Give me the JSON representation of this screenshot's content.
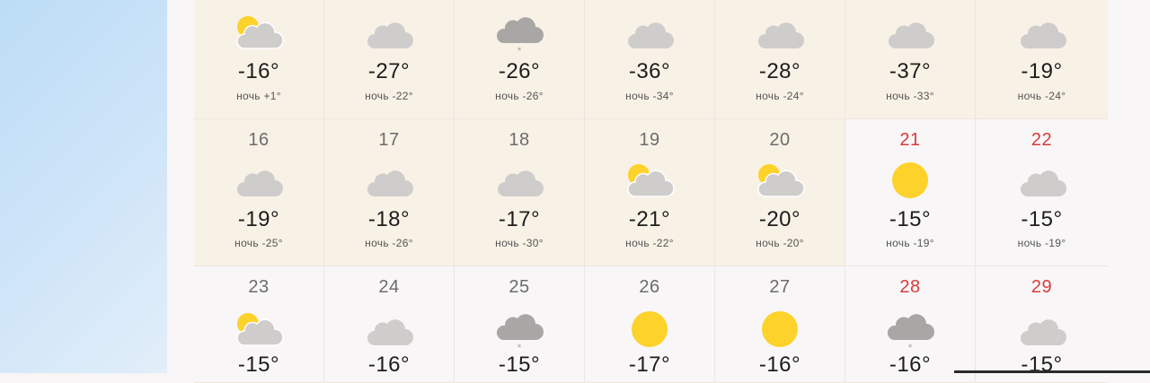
{
  "colors": {
    "past_cell_bg": "#f8f1e6",
    "future_cell_bg": "#f8f6f7",
    "weekend_date": "#d63c3c",
    "sun": "#fdd22a",
    "cloud": "#cfcccc",
    "dark_cloud": "#a9a6a6"
  },
  "calendar": {
    "rows": [
      {
        "days": [
          {
            "date": "",
            "weekend": false,
            "icon": "sun-cloud-icon",
            "temp": "-16°",
            "night": "ночь +1°"
          },
          {
            "date": "",
            "weekend": false,
            "icon": "cloud-icon",
            "temp": "-27°",
            "night": "ночь -22°"
          },
          {
            "date": "",
            "weekend": false,
            "icon": "snow-cloud-icon",
            "temp": "-26°",
            "night": "ночь -26°"
          },
          {
            "date": "",
            "weekend": false,
            "icon": "cloud-icon",
            "temp": "-36°",
            "night": "ночь -34°"
          },
          {
            "date": "",
            "weekend": false,
            "icon": "cloud-icon",
            "temp": "-28°",
            "night": "ночь -24°"
          },
          {
            "date": "",
            "weekend": false,
            "icon": "cloud-icon",
            "temp": "-37°",
            "night": "ночь -33°"
          },
          {
            "date": "",
            "weekend": false,
            "icon": "cloud-icon",
            "temp": "-19°",
            "night": "ночь -24°"
          }
        ]
      },
      {
        "days": [
          {
            "date": "16",
            "weekend": false,
            "icon": "cloud-icon",
            "temp": "-19°",
            "night": "ночь -25°"
          },
          {
            "date": "17",
            "weekend": false,
            "icon": "cloud-icon",
            "temp": "-18°",
            "night": "ночь -26°"
          },
          {
            "date": "18",
            "weekend": false,
            "icon": "cloud-icon",
            "temp": "-17°",
            "night": "ночь -30°"
          },
          {
            "date": "19",
            "weekend": false,
            "icon": "sun-cloud-icon",
            "temp": "-21°",
            "night": "ночь -22°"
          },
          {
            "date": "20",
            "weekend": false,
            "icon": "sun-cloud-icon",
            "temp": "-20°",
            "night": "ночь -20°"
          },
          {
            "date": "21",
            "weekend": true,
            "icon": "sun-icon",
            "temp": "-15°",
            "night": "ночь -19°"
          },
          {
            "date": "22",
            "weekend": true,
            "icon": "cloud-icon",
            "temp": "-15°",
            "night": "ночь -19°"
          }
        ]
      },
      {
        "days": [
          {
            "date": "23",
            "weekend": false,
            "icon": "sun-cloud-icon",
            "temp": "-15°",
            "night": ""
          },
          {
            "date": "24",
            "weekend": false,
            "icon": "cloud-icon",
            "temp": "-16°",
            "night": ""
          },
          {
            "date": "25",
            "weekend": false,
            "icon": "snow-cloud-icon",
            "temp": "-15°",
            "night": ""
          },
          {
            "date": "26",
            "weekend": false,
            "icon": "sun-icon",
            "temp": "-17°",
            "night": ""
          },
          {
            "date": "27",
            "weekend": false,
            "icon": "sun-icon",
            "temp": "-16°",
            "night": ""
          },
          {
            "date": "28",
            "weekend": true,
            "icon": "snow-cloud-icon",
            "temp": "-16°",
            "night": ""
          },
          {
            "date": "29",
            "weekend": true,
            "icon": "cloud-icon",
            "temp": "-15°",
            "night": ""
          }
        ]
      }
    ]
  }
}
